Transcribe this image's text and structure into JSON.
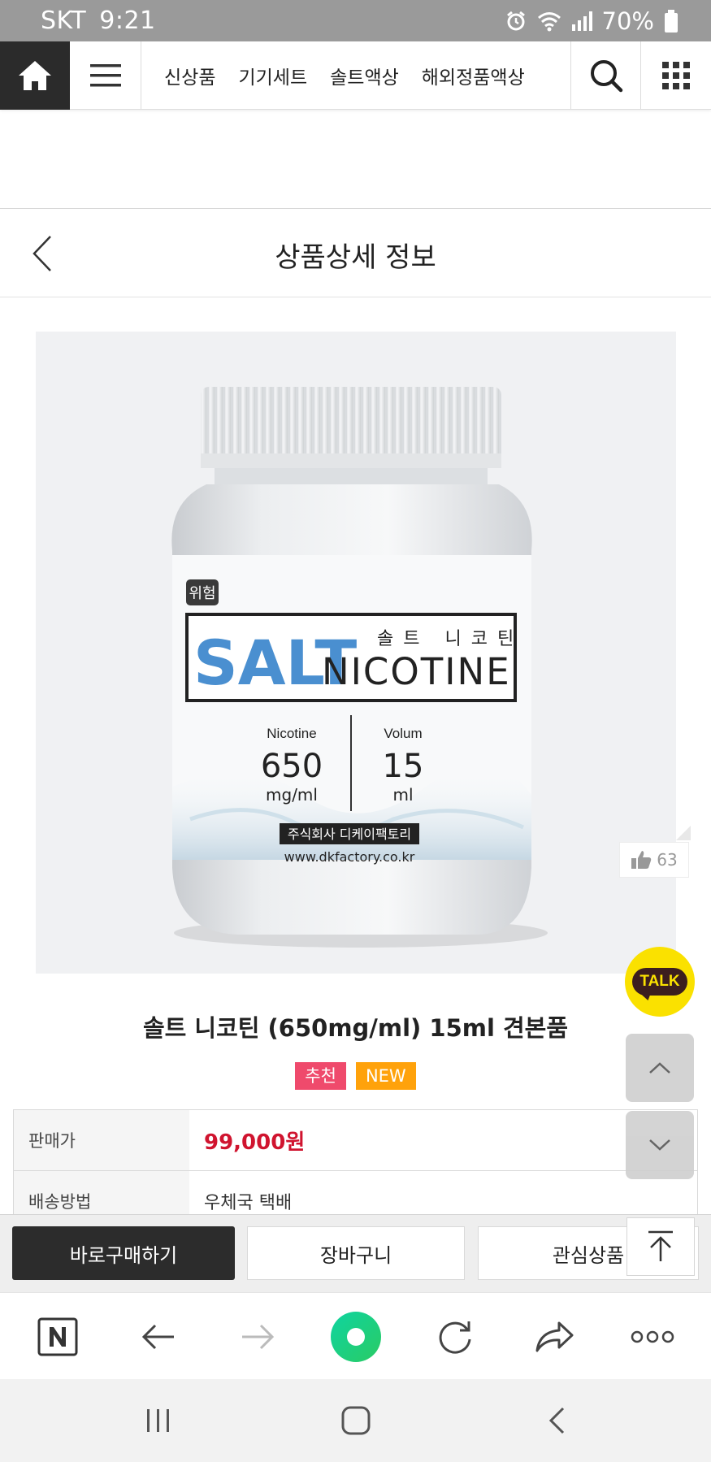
{
  "status_bar": {
    "carrier": "SKT",
    "time": "9:21",
    "battery": "70%"
  },
  "top_nav": {
    "categories": [
      "신상품",
      "기기세트",
      "솔트액상",
      "해외정품액상"
    ]
  },
  "page_header": {
    "title": "상품상세 정보"
  },
  "product_image": {
    "hazard_label": "위험",
    "brand_salt": "SALT",
    "brand_korean": "솔트 니코틴",
    "brand_nicotine": "NICOTINE",
    "spec_left_label": "Nicotine",
    "spec_left_value": "650",
    "spec_left_unit": "mg/ml",
    "spec_right_label": "Volum",
    "spec_right_value": "15",
    "spec_right_unit": "ml",
    "company": "주식회사 디케이팩토리",
    "website": "www.dkfactory.co.kr"
  },
  "like": {
    "count": "63"
  },
  "talk": {
    "label": "TALK"
  },
  "product": {
    "name": "솔트 니코틴 (650mg/ml) 15ml 견본품",
    "badges": [
      "추천",
      "NEW"
    ],
    "info": [
      {
        "label": "판매가",
        "value": "99,000원"
      },
      {
        "label": "배송방법",
        "value": "우체국 택배"
      }
    ]
  },
  "actions": {
    "buy": "바로구매하기",
    "cart": "장바구니",
    "wishlist": "관심상품"
  },
  "browser_toolbar": {
    "icons": [
      "naver-n-icon",
      "back-arrow-icon",
      "forward-arrow-icon",
      "green-dot-icon",
      "refresh-icon",
      "share-icon",
      "more-icon"
    ]
  },
  "colors": {
    "price": "#d0142f",
    "badge_recommend": "#ef4a6c",
    "badge_new": "#ffa20b",
    "kakao_yellow": "#fae100",
    "brand_blue": "#4a8fd0",
    "green_accent": "#1fd495"
  }
}
